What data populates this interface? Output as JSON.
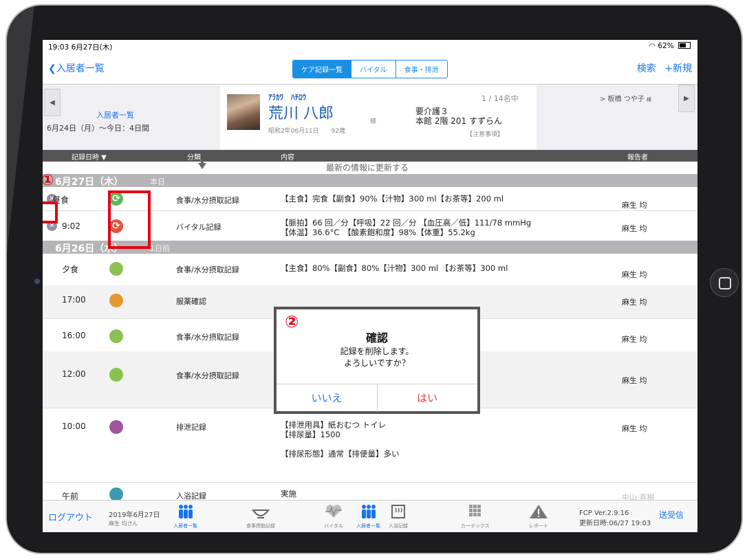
{
  "status": {
    "time": "19:03  6月27日(木)",
    "battery": "62%"
  },
  "nav": {
    "back": "入居者一覧",
    "tabs": [
      "ケア記録一覧",
      "バイタル",
      "食事・排泄"
    ],
    "search": "検索",
    "new": "+新規"
  },
  "profile": {
    "list_link": "入居者一覧",
    "range": "6月24日（月）〜今日：4日間",
    "kana": "ｱﾗｶﾜ　ﾊﾁﾛｳ",
    "name": "荒川 八郎",
    "sama": "様",
    "birth": "昭和2年06月11日　　92歳",
    "count": "1 / 14名中",
    "care_level": "要介護３",
    "room": "本館 2階 201 すずらん",
    "notice": "【注意事項】",
    "next_resident": "> 板橋 つや子",
    "next_suffix": "様"
  },
  "columns": {
    "datetime": "記録日時 ▼",
    "category": "分類",
    "content": "内容",
    "reporter": "報告者"
  },
  "refresh_text": "最新の情報に更新する",
  "days": [
    {
      "date": "6月27日（木）",
      "relative": "本日",
      "rows": [
        {
          "time": "昼食",
          "category": "食事/水分摂取記録",
          "content": [
            "【主食】完食【副食】90%【汁物】300 ml【お茶等】200 ml"
          ],
          "reporter": "麻生 均",
          "sync_color": "#5cb85c"
        },
        {
          "time": "9:02",
          "category": "バイタル記録",
          "content": [
            "【脈拍】66 回／分【呼吸】22 回／分 【血圧高／低】111/78 mmHg",
            "【体温】36.6°C　【酸素飽和度】98%【体重】55.2kg"
          ],
          "reporter": "麻生 均",
          "sync_color": "#e5533d"
        }
      ]
    },
    {
      "date": "6月26日（水）",
      "relative": "1日前",
      "rows": [
        {
          "time": "夕食",
          "category": "食事/水分摂取記録",
          "content": [
            "【主食】80%【副食】80%【汁物】300 ml 【お茶等】300 ml"
          ],
          "reporter": "麻生 均",
          "color": "#8cc152"
        },
        {
          "time": "17:00",
          "category": "服薬確認",
          "content": [],
          "reporter": "麻生 均",
          "color": "#e8962e"
        },
        {
          "time": "16:00",
          "category": "食事/水分摂取記録",
          "content": [],
          "reporter": "麻生 均",
          "color": "#8cc152"
        },
        {
          "time": "12:00",
          "category": "食事/水分摂取記録",
          "content": [],
          "reporter": "麻生 均",
          "color": "#8cc152"
        },
        {
          "time": "10:00",
          "category": "排泄記録",
          "content": [
            "【排泄用具】紙おむつ  トイレ",
            "【排尿量】1500",
            "",
            "【排尿形態】通常【排便量】多い"
          ],
          "reporter": "麻生 均",
          "color": "#a0559e"
        },
        {
          "time": "午前",
          "category": "入浴記録",
          "content": [
            "実施"
          ],
          "reporter": "中山 直樹",
          "color": "#3b9bb0"
        }
      ]
    }
  ],
  "annotations": {
    "one": "①",
    "two": "②"
  },
  "dialog": {
    "title": "確認",
    "message1": "記録を削除します。",
    "message2": "よろしいですか？",
    "no": "いいえ",
    "yes": "はい"
  },
  "tabbar": {
    "logout": "ログアウト",
    "date": "2019年6月27日",
    "user": "麻生 均さん",
    "tabs": [
      "入居者一覧",
      "食事摂取記録",
      "バイタル",
      "入居者一覧",
      "入浴記録",
      "カーデックス",
      "レポート"
    ],
    "version": "FCP Ver.2.9.16",
    "updated": "更新日時:06/27 19:03",
    "send_receive": "送受信"
  },
  "colors": {
    "accent": "#1a73e8",
    "highlight": "#e60012"
  }
}
